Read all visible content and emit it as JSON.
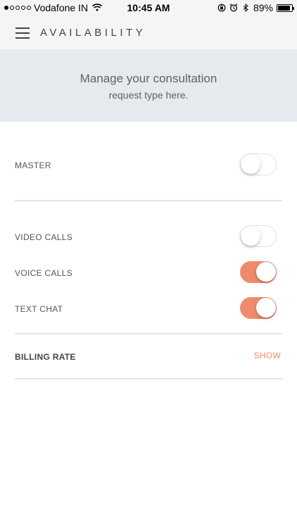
{
  "status_bar": {
    "carrier": "Vodafone IN",
    "time": "10:45 AM",
    "battery": "89%",
    "battery_level": 0.89,
    "signal_bars_filled": 1,
    "signal_bars_total": 5,
    "icons": [
      "wifi-icon",
      "orientation-lock-icon",
      "alarm-icon",
      "bluetooth-icon",
      "battery-icon"
    ]
  },
  "header": {
    "title": "AVAILABILITY",
    "menu_icon": "hamburger-menu-icon"
  },
  "info": {
    "line1": "Manage your consultation",
    "line2": "request type here."
  },
  "settings": {
    "master": {
      "label": "MASTER",
      "enabled": false
    },
    "video_calls": {
      "label": "VIDEO CALLS",
      "enabled": false
    },
    "voice_calls": {
      "label": "VOICE CALLS",
      "enabled": true
    },
    "text_chat": {
      "label": "TEXT CHAT",
      "enabled": true
    }
  },
  "billing": {
    "label": "BILLING RATE",
    "action": "SHOW"
  },
  "colors": {
    "accent": "#f08a6c",
    "banner_bg": "#e6eaee",
    "header_bg": "#f5f5f5"
  }
}
